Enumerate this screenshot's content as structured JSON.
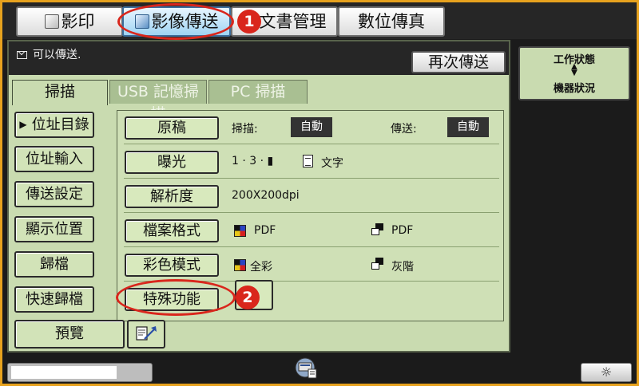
{
  "mode_tabs": [
    {
      "label": "影印",
      "icon": "copy-icon"
    },
    {
      "label": "影像傳送",
      "icon": "image-send-icon",
      "active": true
    },
    {
      "label": "文書管理",
      "icon": "document-filing-icon"
    },
    {
      "label": "數位傳真"
    }
  ],
  "status": {
    "message": "可以傳送.",
    "icon": "mail-icon"
  },
  "resend_label": "再次傳送",
  "sub_tabs": [
    {
      "label": "掃描",
      "active": true
    },
    {
      "label": "USB 記憶掃描"
    },
    {
      "label": "PC 掃描"
    }
  ],
  "sidebar": {
    "items": [
      {
        "label": "位址目錄",
        "selected": true
      },
      {
        "label": "位址輸入"
      },
      {
        "label": "傳送設定"
      },
      {
        "label": "顯示位置"
      },
      {
        "label": "歸檔"
      },
      {
        "label": "快速歸檔"
      }
    ]
  },
  "settings": {
    "original": {
      "button": "原稿",
      "scan_label": "掃描:",
      "scan_value": "自動",
      "send_label": "傳送:",
      "send_value": "自動"
    },
    "exposure": {
      "button": "曝光",
      "value": "1 · 3 · ▮",
      "text": "文字"
    },
    "resolution": {
      "button": "解析度",
      "value": "200X200dpi"
    },
    "file_format": {
      "button": "檔案格式",
      "color_value": "PDF",
      "bw_value": "PDF"
    },
    "color_mode": {
      "button": "彩色模式",
      "color_value": "全彩",
      "bw_value": "灰階"
    },
    "special": {
      "button": "特殊功能"
    }
  },
  "preview_label": "預覽",
  "status_panel": {
    "top": "工作狀態",
    "bottom": "機器狀況"
  },
  "callouts": {
    "first": "1",
    "second": "2"
  },
  "colors": {
    "accent": "#d9261c",
    "panel": "#c9dbb0",
    "frame": "#e7a21e"
  },
  "progress": {
    "fill": 0.77
  }
}
